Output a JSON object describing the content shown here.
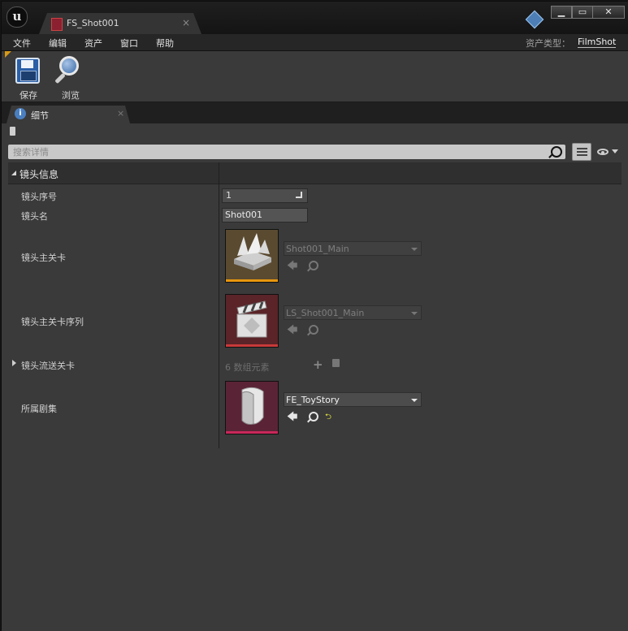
{
  "window": {
    "doc_tab_title": "FS_Shot001",
    "tab_close": "×",
    "controls": {
      "minimize": "▁",
      "maximize": "▭",
      "close": "✕"
    }
  },
  "menu": {
    "items": [
      "文件",
      "编辑",
      "资产",
      "窗口",
      "帮助"
    ],
    "asset_type_label": "资产类型：",
    "asset_type_value": "FilmShot"
  },
  "toolbar": {
    "save_label": "保存",
    "browse_label": "浏览"
  },
  "details": {
    "tab_label": "细节",
    "tab_close": "×",
    "search_placeholder": "搜索详情",
    "category": "镜头信息",
    "properties": {
      "shot_index": {
        "label": "镜头序号",
        "value": "1"
      },
      "shot_name": {
        "label": "镜头名",
        "value": "Shot001"
      },
      "main_level": {
        "label": "镜头主关卡",
        "asset": "Shot001_Main",
        "thumb_color": "#e8960f"
      },
      "main_sequence": {
        "label": "镜头主关卡序列",
        "asset": "LS_Shot001_Main",
        "thumb_color": "#c83a3a"
      },
      "streaming_levels": {
        "label": "镜头流送关卡",
        "count_text": "6 数组元素",
        "add": "+"
      },
      "episode": {
        "label": "所属剧集",
        "asset": "FE_ToyStory",
        "thumb_color": "#c8285a"
      }
    },
    "icons": {
      "back_arrow": "🡄",
      "reset": "⮌"
    }
  }
}
